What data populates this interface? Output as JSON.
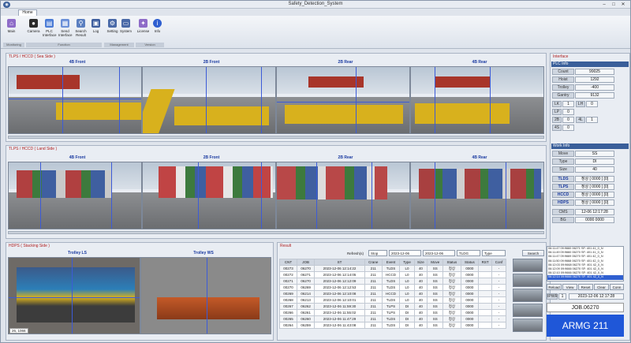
{
  "window": {
    "title": "Safety_Detection_System"
  },
  "ribbon": {
    "tab": "Home",
    "buttons": [
      {
        "label": "Main"
      },
      {
        "label": "Camera"
      },
      {
        "label": "PLC\nInterface"
      },
      {
        "label": "Send\nInterface"
      },
      {
        "label": "Search\nResult"
      },
      {
        "label": "Log"
      },
      {
        "label": "Setting"
      },
      {
        "label": "System"
      },
      {
        "label": "License"
      },
      {
        "label": "Info"
      }
    ],
    "groups": [
      "Monitoring",
      "Function",
      "Management",
      "Version"
    ]
  },
  "sea_panel": {
    "title": "TLPS / HCCD ( Sea Side )",
    "cams": [
      "4B Front",
      "2B Front",
      "2B Rear",
      "4B Rear"
    ]
  },
  "land_panel": {
    "title": "TLPS / HCCD ( Land Side )",
    "cams": [
      "4B Front",
      "2B Front",
      "2B Rear",
      "4B Rear"
    ]
  },
  "hdps_panel": {
    "title": "HDPS ( Stacking Side )",
    "cams": [
      "Trolley LS",
      "Trolley WS"
    ],
    "footer": "26, 1066"
  },
  "result": {
    "title": "Result",
    "refresh_label": "Refresh(s)",
    "refresh_value": "Stop",
    "date_from": "2023-12-06",
    "date_to": "2023-12-06",
    "filter": "TLDG",
    "type": "Type",
    "search_label": "Search",
    "columns": [
      "CNT",
      "JOB",
      "ST",
      "Crane",
      "Event",
      "Type",
      "Size",
      "Move",
      "Status",
      "Status",
      "RST",
      "Conf"
    ],
    "rows": [
      [
        "00273",
        "06270",
        "2023-12-06 12:14:22",
        "211",
        "TLDS",
        "L0",
        "40",
        "SS",
        "정상",
        "0000",
        "",
        "-"
      ],
      [
        "00272",
        "06271",
        "2023-12-06 12:14:05",
        "211",
        "HCCD",
        "L0",
        "40",
        "SS",
        "정상",
        "0000",
        "",
        "-"
      ],
      [
        "00271",
        "06270",
        "2023-12-06 12:12:09",
        "211",
        "TLDS",
        "L0",
        "40",
        "SS",
        "정상",
        "0000",
        "",
        "-"
      ],
      [
        "00270",
        "06269",
        "2023-12-06 12:12:53",
        "211",
        "TLDS",
        "L0",
        "40",
        "SS",
        "정상",
        "0000",
        "",
        "-"
      ],
      [
        "00269",
        "06214",
        "2023-12-06 12:10:08",
        "211",
        "HCCD",
        "L0",
        "40",
        "SS",
        "정상",
        "0000",
        "",
        "-"
      ],
      [
        "00268",
        "06213",
        "2023-12-06 12:10:01",
        "211",
        "TLDS",
        "L0",
        "40",
        "SS",
        "정상",
        "0000",
        "",
        "-"
      ],
      [
        "00267",
        "06262",
        "2023-12-06 11:59:30",
        "211",
        "TLPS",
        "DI",
        "40",
        "SS",
        "정상",
        "0000",
        "",
        "-"
      ],
      [
        "00266",
        "06261",
        "2023-12-06 11:55:02",
        "211",
        "TLPS",
        "DI",
        "40",
        "SS",
        "정상",
        "0000",
        "",
        "-"
      ],
      [
        "00265",
        "06260",
        "2023-12-06 11:47:29",
        "211",
        "TLDS",
        "DI",
        "40",
        "SS",
        "정상",
        "0000",
        "",
        "-"
      ],
      [
        "00264",
        "06259",
        "2023-12-06 11:43:08",
        "211",
        "TLDS",
        "DI",
        "40",
        "SS",
        "정상",
        "0000",
        "",
        "-"
      ]
    ]
  },
  "interface": {
    "title": "Interface",
    "plc_title": "PLC Info",
    "plc": [
      {
        "label": "Count",
        "value": "99025"
      },
      {
        "label": "Hoist",
        "value": "1292"
      },
      {
        "label": "Trolley",
        "value": "-400"
      },
      {
        "label": "Gantry",
        "value": "9132"
      }
    ],
    "plc_small": [
      [
        "LK",
        "1",
        "LH",
        "0"
      ],
      [
        "LP",
        "0",
        "",
        ""
      ],
      [
        "2B",
        "0",
        "4L",
        "1"
      ],
      [
        "4S",
        "0",
        "",
        ""
      ]
    ],
    "work_title": "Work Info",
    "work": [
      {
        "label": "Move",
        "value": "SS"
      },
      {
        "label": "Type",
        "value": "DI"
      },
      {
        "label": "Size",
        "value": "40"
      }
    ],
    "status": [
      {
        "label": "TLDS",
        "value": "정상 [ 0000 ] [0]"
      },
      {
        "label": "TLPS",
        "value": "정상 [ 0000 ] [0]"
      },
      {
        "label": "HCCD",
        "value": "정상 [ 0000 ] [0]"
      },
      {
        "label": "HDPS",
        "value": "정상 [ 0000 ] [0]"
      }
    ],
    "cms": {
      "label": "CMS",
      "value": "12-06 12:17:28"
    },
    "bg": {
      "label": "BG",
      "value": "0000 0000"
    },
    "log": [
      "06:11:47 09:9660 06271 SF: 401 41_0_N",
      "06:11:49 09:9660 06270 SF: 401 41_0_N",
      "06:11:47 09:9669 06270 SF: 401 42_0_N",
      "06:11:50 09:9668 06270 SF: 401 42_0_N",
      "06:12:03 09:9668 06270 SF: 401 42_0_N",
      "06:12:09 09:9666 06270 SF: 401 42_0_N",
      "06:12:10 09:9666 06270 SF: 401 42_0_N",
      "06:12:14 09:9666 06270 SF: 401 42_0_N"
    ],
    "log_buttons": [
      "Reload",
      "View",
      "Reset",
      "Clear",
      "Conn"
    ],
    "ipwr_label": "IPWR",
    "ipwr_value": "1",
    "ipwr_time": "2023-12-06 12:17:28",
    "job": "JOB.06270",
    "armg": "ARMG 211"
  },
  "colors": {
    "accent": "#1f57d8",
    "title_red": "#b02020",
    "cam_label": "#1a3aa0"
  }
}
